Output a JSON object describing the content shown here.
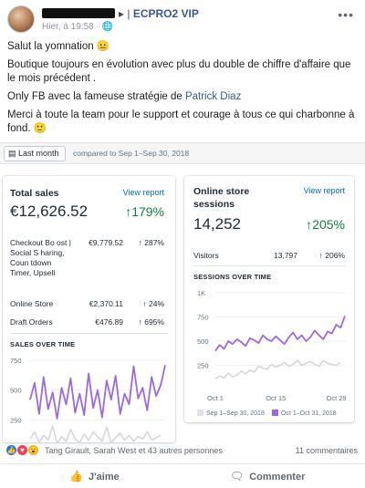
{
  "post": {
    "author_tail": "▸",
    "group": "ECPRO2 VIP",
    "time": "Hier, à 19:58 · ",
    "globe_icon": "globe-icon",
    "lines": [
      "Salut la yomnation 😐",
      "Boutique toujours en évolution avec plus du double de chiffre d'affaire que le mois précédent .",
      "Only FB avec la fameuse stratégie de ",
      "Merci à toute la team pour le support et courage à tous ce qui charbonne à fond. 🙂"
    ],
    "link": "Patrick Diaz"
  },
  "report": {
    "date_button": "Last month",
    "compare": "compared to Sep 1–Sep 30, 2018"
  },
  "sales_card": {
    "title": "Total sales",
    "view_report": "View report",
    "value": "€12,626.52",
    "change": "↑179%",
    "rows": [
      {
        "label": "Checkout Bo ost | Social S haring, Coun tdown Timer, Upsell",
        "value": "€9,779.52",
        "change": "↑ 287%"
      },
      {
        "label": "Online Store",
        "value": "€2,370.11",
        "change": "↑ 24%"
      },
      {
        "label": "Draft Orders",
        "value": "€476.89",
        "change": "↑ 695%"
      }
    ],
    "chart_label": "SALES OVER TIME"
  },
  "sessions_card": {
    "title": "Online store sessions",
    "view_report": "View report",
    "value": "14,252",
    "change": "↑205%",
    "visitors_label": "Visitors",
    "visitors_value": "13,797",
    "visitors_change": "↑ 206%",
    "chart_label": "SESSIONS OVER TIME",
    "legend_prev": "Sep 1–Sep 30, 2018",
    "legend_curr": "Oct 1–Oct 31, 2018"
  },
  "footer": {
    "reactors": "Tang Girault, Sarah West et 43 autres personnes",
    "comments": "11 commentaires",
    "like": "J'aime",
    "comment": "Commenter"
  },
  "colors": {
    "current": "#9c6ade",
    "previous": "#dfe3e8",
    "up": "#108043",
    "link": "#385898",
    "shopify_link": "#006fbb"
  },
  "chart_data": [
    {
      "type": "line",
      "title": "SALES OVER TIME",
      "ylim": [
        0,
        750
      ],
      "yticks": [
        "750",
        "500",
        "250"
      ],
      "series": [
        {
          "name": "Oct 1–Oct 31, 2018",
          "values": [
            420,
            560,
            300,
            610,
            340,
            480,
            260,
            520,
            380,
            600,
            310,
            470,
            290,
            640,
            350,
            500,
            270,
            580,
            420,
            620,
            300,
            470,
            380,
            700,
            430,
            520,
            330,
            610,
            450,
            540,
            710
          ]
        },
        {
          "name": "Sep 1–Sep 30, 2018",
          "values": [
            90,
            150,
            60,
            120,
            80,
            200,
            50,
            110,
            70,
            170,
            90,
            60,
            130,
            80,
            150,
            110,
            70,
            190,
            60,
            100,
            140,
            80,
            120,
            70,
            110,
            90,
            150,
            80,
            100,
            120
          ]
        }
      ]
    },
    {
      "type": "line",
      "title": "SESSIONS OVER TIME",
      "ylim": [
        0,
        1000
      ],
      "yticks": [
        "1K",
        "750",
        "500",
        "250"
      ],
      "xticks": [
        "Oct 1",
        "Oct 15",
        "Oct 29"
      ],
      "series": [
        {
          "name": "Oct 1–Oct 31, 2018",
          "values": [
            400,
            460,
            420,
            500,
            470,
            520,
            490,
            450,
            530,
            510,
            480,
            560,
            520,
            500,
            550,
            510,
            470,
            540,
            590,
            520,
            560,
            500,
            540,
            610,
            560,
            520,
            600,
            580,
            670,
            640,
            760
          ]
        },
        {
          "name": "Sep 1–Sep 30, 2018",
          "values": [
            110,
            140,
            120,
            170,
            130,
            150,
            190,
            160,
            200,
            180,
            240,
            220,
            210,
            260,
            230,
            250,
            280,
            240,
            260,
            300,
            250,
            270,
            290,
            260,
            240,
            300,
            270,
            260,
            250,
            280
          ]
        }
      ]
    }
  ]
}
